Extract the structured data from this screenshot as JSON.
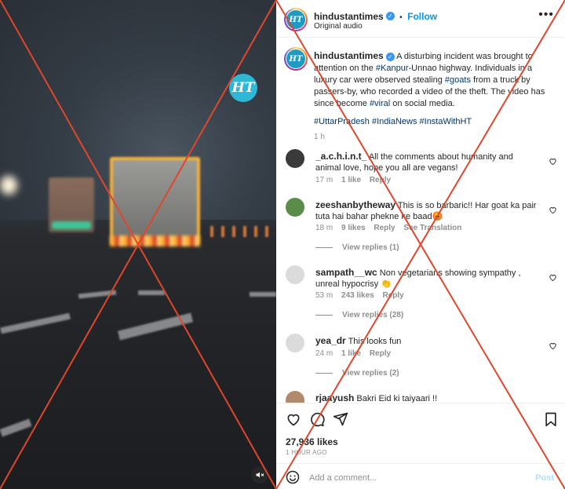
{
  "post": {
    "account": "hindustantimes",
    "follow_label": "Follow",
    "separator": "•",
    "audio": "Original audio",
    "logo_text": "HT",
    "caption_parts": [
      {
        "text": " A disturbing incident was brought to attention on the ",
        "tag": false
      },
      {
        "text": "#Kanpur",
        "tag": true
      },
      {
        "text": "-Unnao highway. Individuals in a luxury car were observed stealing ",
        "tag": false
      },
      {
        "text": "#goats",
        "tag": true
      },
      {
        "text": " from a truck by passers-by, who recorded a video of the theft. The video has since become ",
        "tag": false
      },
      {
        "text": "#viral",
        "tag": true
      },
      {
        "text": " on social media.",
        "tag": false
      }
    ],
    "hashtags": "#UttarPradesh #IndiaNews #InstaWithHT",
    "caption_time": "1 h"
  },
  "comments": [
    {
      "user": "_a.c.h.i.n.t_",
      "text": "All the comments about humanity and animal love, hope you all are vegans!",
      "time": "17 m",
      "likes": "1 like",
      "reply": "Reply",
      "translate": "",
      "replies": ""
    },
    {
      "user": "zeeshanbytheway",
      "text": "This is so barbaric!! Har goat ka pair tuta hai bahar phekne ke baad😡",
      "time": "18 m",
      "likes": "9 likes",
      "reply": "Reply",
      "translate": "See Translation",
      "replies": "View replies (1)"
    },
    {
      "user": "sampath__wc",
      "text": "Non vegetarians showing sympathy , unreal hypocrisy 👏",
      "time": "53 m",
      "likes": "243 likes",
      "reply": "Reply",
      "translate": "",
      "replies": "View replies (28)"
    },
    {
      "user": "yea_dr",
      "text": "This looks fun",
      "time": "24 m",
      "likes": "1 like",
      "reply": "Reply",
      "translate": "",
      "replies": "View replies (2)"
    },
    {
      "user": "rjaayush",
      "text": "Bakri Eid ki taiyaari !!",
      "time": "",
      "likes": "",
      "reply": "",
      "translate": "",
      "replies": ""
    }
  ],
  "footer": {
    "likes": "27,936 likes",
    "ago": "1 HOUR AGO",
    "comment_placeholder": "Add a comment...",
    "post_label": "Post"
  },
  "colors": {
    "accent": "#0095f6",
    "hashtag": "#00376b",
    "cross_out": "#e0462b"
  }
}
